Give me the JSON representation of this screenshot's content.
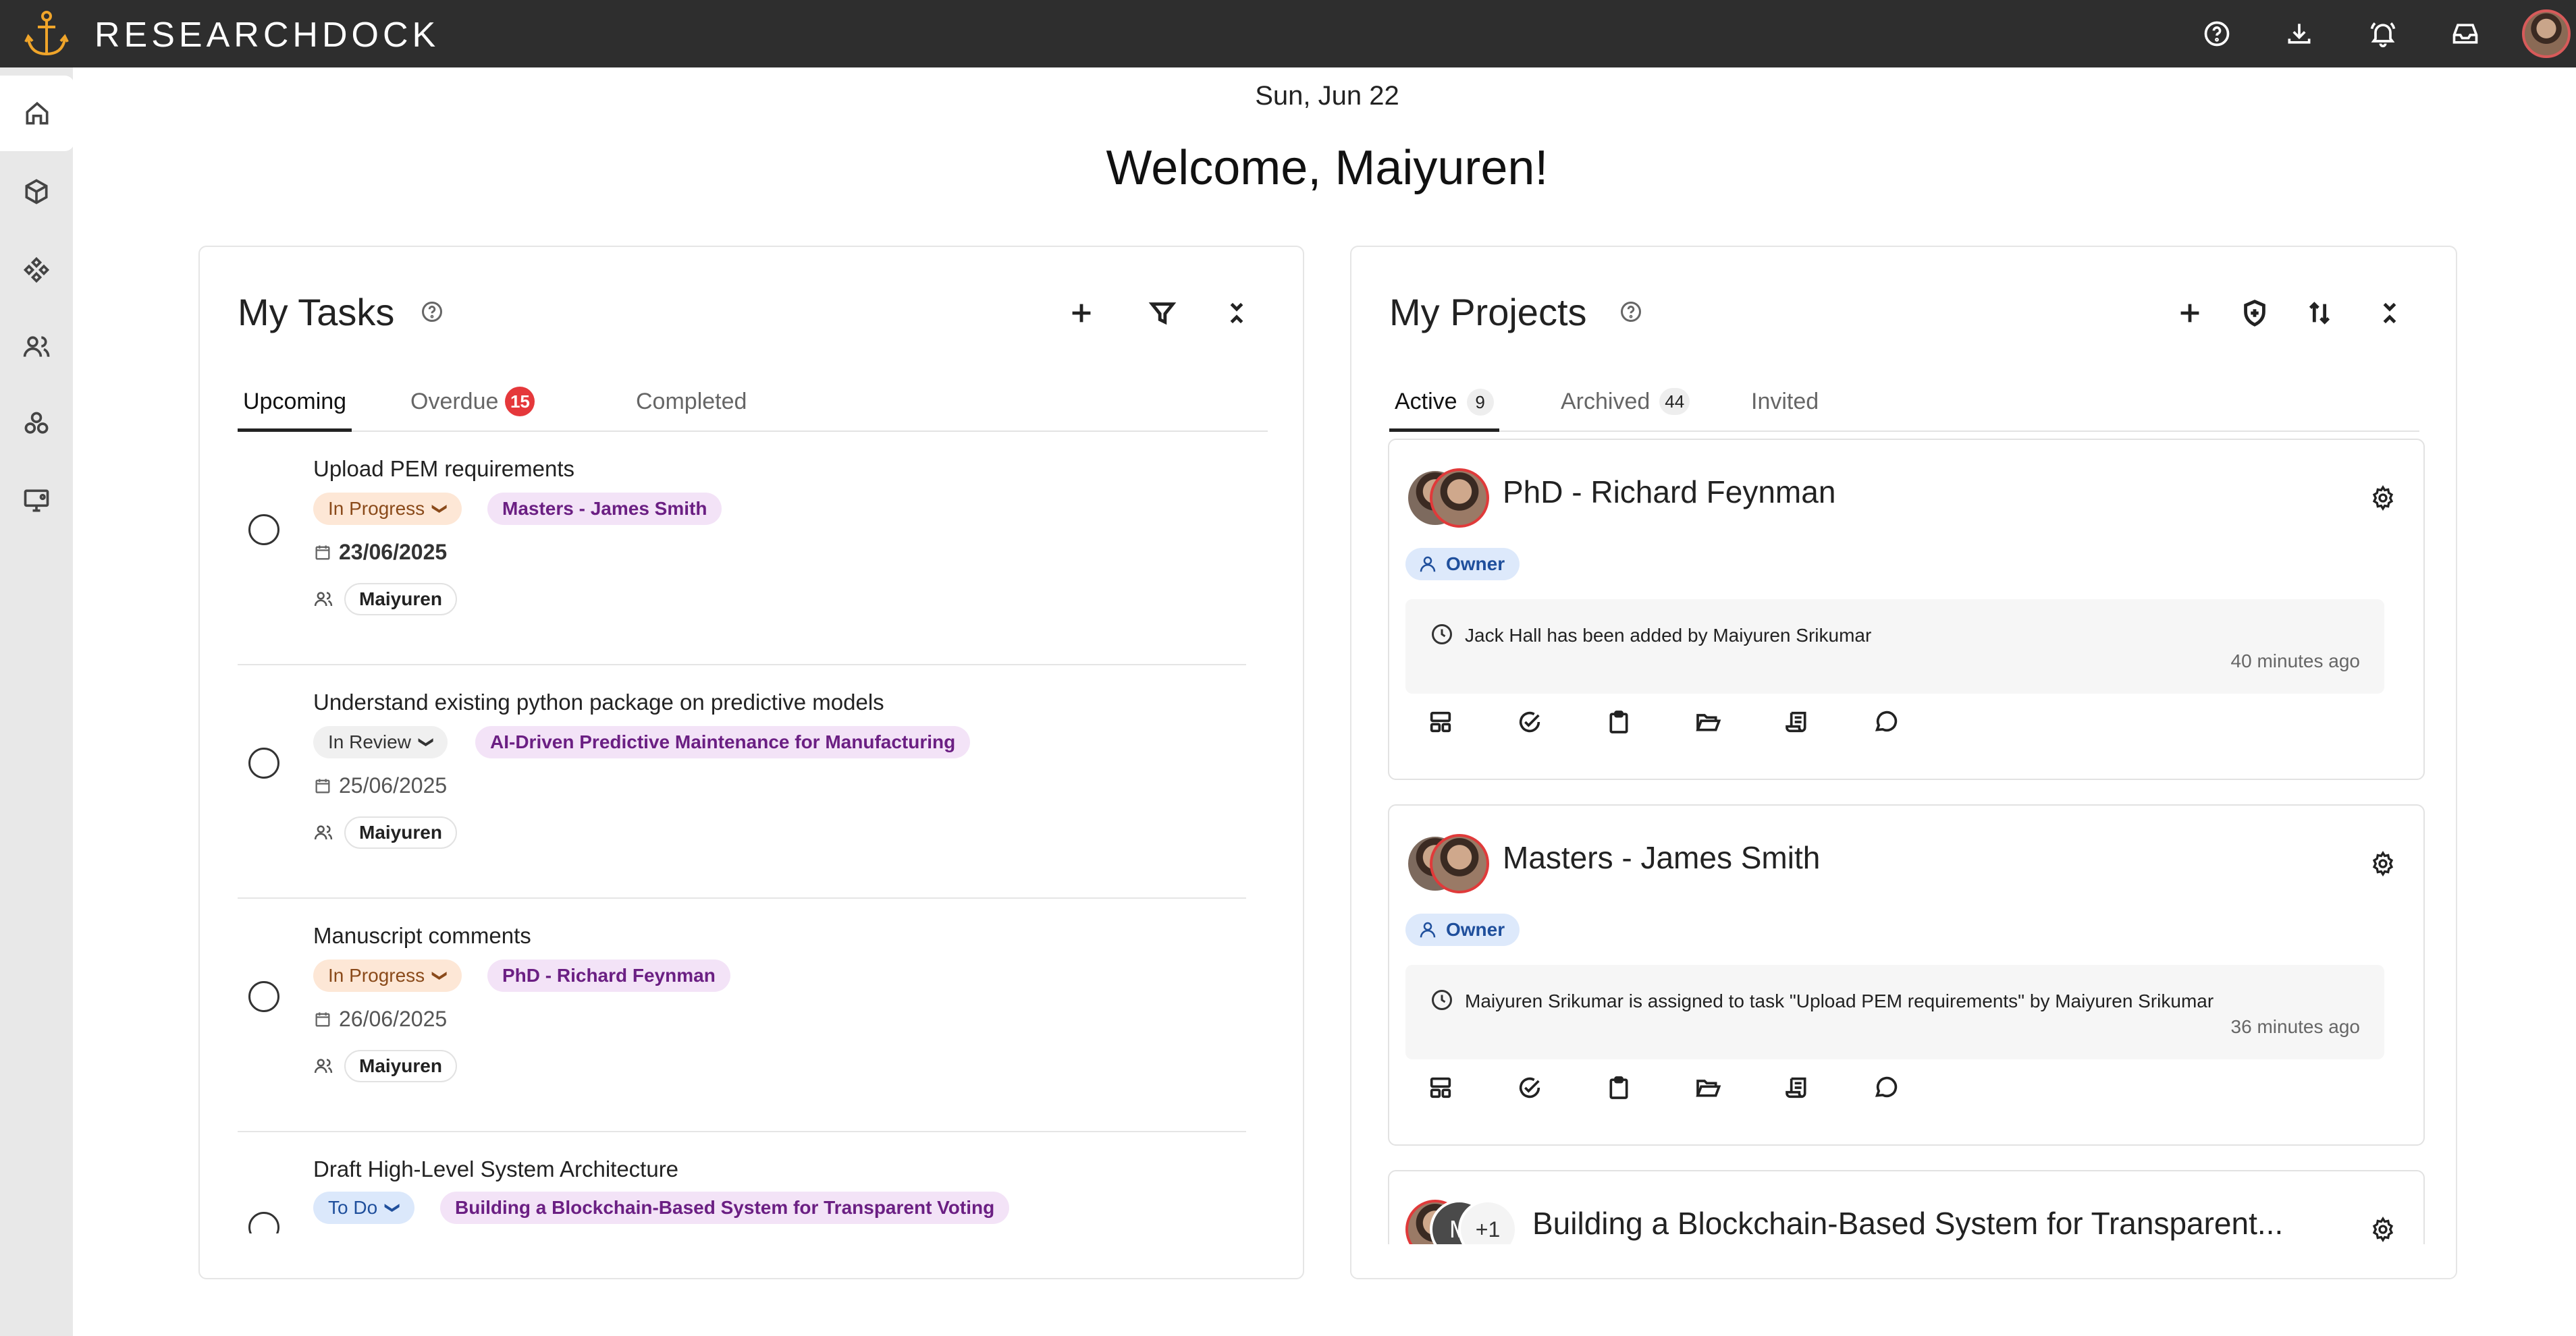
{
  "app": {
    "brand": "RESEARCHDOCK"
  },
  "header": {
    "date": "Sun, Jun 22",
    "welcome": "Welcome, Maiyuren!"
  },
  "top_icons": [
    "help-icon",
    "download-icon",
    "bell-icon",
    "inbox-icon",
    "avatar"
  ],
  "sidebar": {
    "items": [
      "home-icon",
      "cube-icon",
      "components-icon",
      "users-icon",
      "boxes-icon",
      "monitor-icon"
    ]
  },
  "tasks": {
    "title": "My Tasks",
    "tabs": [
      {
        "label": "Upcoming",
        "active": true
      },
      {
        "label": "Overdue",
        "count": "15"
      },
      {
        "label": "Completed"
      }
    ],
    "items": [
      {
        "title": "Upload PEM requirements",
        "status": "In Progress",
        "project": "Masters - James Smith",
        "date": "23/06/2025",
        "assignee": "Maiyuren"
      },
      {
        "title": "Understand existing python package on predictive models",
        "status": "In Review",
        "project": "AI-Driven Predictive Maintenance for Manufacturing",
        "date": "25/06/2025",
        "assignee": "Maiyuren"
      },
      {
        "title": "Manuscript comments",
        "status": "In Progress",
        "project": "PhD - Richard Feynman",
        "date": "26/06/2025",
        "assignee": "Maiyuren"
      },
      {
        "title": "Draft High-Level System Architecture",
        "status": "To Do",
        "project": "Building a Blockchain-Based System for Transparent Voting",
        "date": "",
        "assignee": ""
      }
    ]
  },
  "projects": {
    "title": "My Projects",
    "tabs": [
      {
        "label": "Active",
        "count": "9",
        "active": true
      },
      {
        "label": "Archived",
        "count": "44"
      },
      {
        "label": "Invited"
      }
    ],
    "items": [
      {
        "title": "PhD - Richard Feynman",
        "role": "Owner",
        "activity": "Jack Hall has been added by Maiyuren Srikumar",
        "time": "40 minutes ago"
      },
      {
        "title": "Masters - James Smith",
        "role": "Owner",
        "activity": "Maiyuren Srikumar is assigned to task \"Upload PEM requirements\" by Maiyuren Srikumar",
        "time": "36 minutes ago"
      },
      {
        "title": "Building a Blockchain-Based System for Transparent...",
        "avatar_letter": "M",
        "avatar_more": "+1"
      }
    ]
  },
  "colors": {
    "topbar": "#2e2e2e",
    "brand_icon": "#f0a52a",
    "overdue_badge": "#e5383b",
    "project_pill": "#f3e3f7",
    "owner_chip": "#dde9fb"
  }
}
